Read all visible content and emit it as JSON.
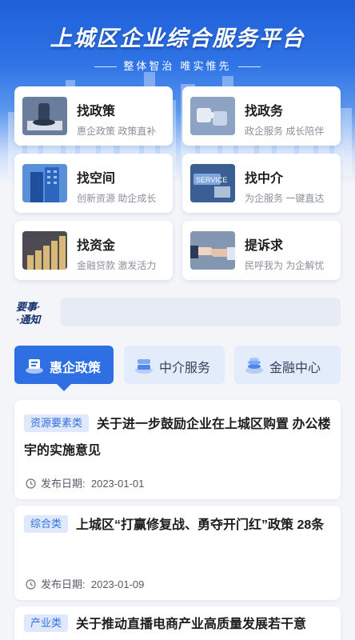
{
  "header": {
    "title": "上城区企业综合服务平台",
    "subtitle": "整体智治 唯实惟先"
  },
  "services": [
    {
      "title": "找政策",
      "desc": "惠企政策 政策直补",
      "icon": "stamp-image"
    },
    {
      "title": "找政务",
      "desc": "政企服务 成长陪伴",
      "icon": "puzzle-image"
    },
    {
      "title": "找空间",
      "desc": "创新资源 助企成长",
      "icon": "building-image"
    },
    {
      "title": "找中介",
      "desc": "为企服务 一键直达",
      "icon": "service-image"
    },
    {
      "title": "找资金",
      "desc": "金融贷款 激发活力",
      "icon": "coins-image"
    },
    {
      "title": "提诉求",
      "desc": "民呼我为 为企解忧",
      "icon": "handshake-image"
    }
  ],
  "notice": {
    "logo_line1": "要事·",
    "logo_line2": "·通知",
    "text": ""
  },
  "tabs": [
    {
      "label": "惠企政策",
      "icon": "policy-stack-icon",
      "active": true
    },
    {
      "label": "中介服务",
      "icon": "service-stack-icon",
      "active": false
    },
    {
      "label": "金融中心",
      "icon": "finance-stack-icon",
      "active": false
    }
  ],
  "policies": [
    {
      "tag": "资源要素类",
      "title": "关于进一步鼓励企业在上城区购置 办公楼宇的实施意见",
      "date_label": "发布日期:",
      "date": "2023-01-01"
    },
    {
      "tag": "综合类",
      "title": "上城区“打赢修复战、勇夺开门红”政策 28条",
      "date_label": "发布日期:",
      "date": "2023-01-09"
    },
    {
      "tag": "产业类",
      "title": "关于推动直播电商产业高质量发展若干意",
      "date_label": "",
      "date": ""
    }
  ],
  "colors": {
    "primary": "#2f6fe4",
    "tag_bg": "#dfe9fb",
    "page_bg": "#f3f5f9"
  }
}
